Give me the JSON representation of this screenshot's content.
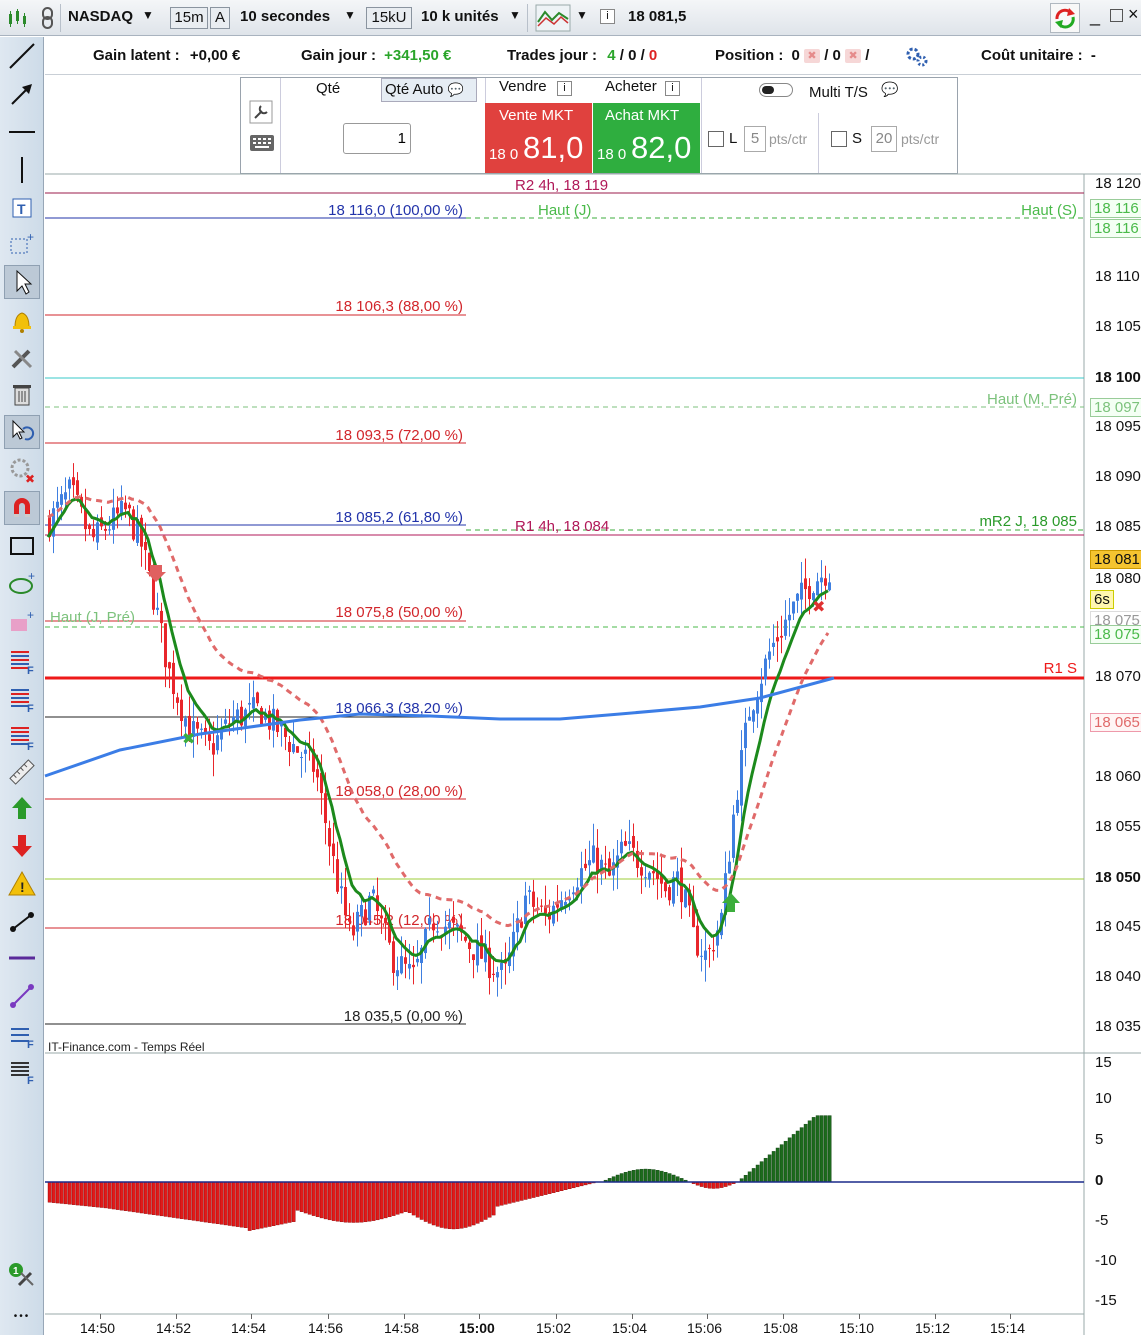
{
  "toolbar": {
    "symbol": "NASDAQ",
    "timeframe": "15m",
    "mode_a": "A",
    "interval": "10 secondes",
    "units_short": "15kU",
    "units": "10 k unités",
    "last_price": "18 081,5"
  },
  "infobar": {
    "gain_latent_label": "Gain latent :",
    "gain_latent_value": "+0,00 €",
    "gain_jour_label": "Gain jour :",
    "gain_jour_value": "+341,50 €",
    "trades_label": "Trades jour :",
    "trades_won": "4",
    "trades_sep1": "/",
    "trades_lost": "0",
    "trades_sep2": "/",
    "trades_open": "0",
    "position_label": "Position :",
    "position_long": "0",
    "position_sep1": "/",
    "position_short": "0",
    "position_sep2": "/",
    "cout_label": "Coût unitaire :",
    "cout_value": "-"
  },
  "order": {
    "qty_label": "Qté",
    "qty_auto_label": "Qté Auto",
    "qty_value": "1",
    "sell_label": "Vendre",
    "buy_label": "Acheter",
    "sell_mkt": "Vente MKT",
    "buy_mkt": "Achat MKT",
    "sell_price_small": "18 0",
    "sell_price_big": "81,0",
    "buy_price_small": "18 0",
    "buy_price_big": "82,0",
    "multi_ts": "Multi T/S",
    "l_label": "L",
    "l_value": "5",
    "s_label": "S",
    "s_value": "20",
    "pts_unit": "pts/ctr"
  },
  "chart": {
    "source": "IT-Finance.com - Temps Réel",
    "levels": {
      "r2_4h": "R2 4h, 18 119",
      "fib100": "18 116,0 (100,00 %)",
      "haut_j": "Haut (J)",
      "haut_s": "Haut (S)",
      "fib88": "18 106,3 (88,00 %)",
      "haut_m_pre": "Haut (M, Pré)",
      "fib72": "18 093,5 (72,00 %)",
      "fib618": "18 085,2 (61,80 %)",
      "r1_4h": "R1 4h, 18 084",
      "mr2_j": "mR2 J, 18 085",
      "haut_j_pre": "Haut (J, Pré)",
      "fib50": "18 075,8 (50,00 %)",
      "r1_s": "R1 S",
      "fib382": "18 066,3 (38,20 %)",
      "fib28": "18 058,0 (28,00 %)",
      "fib12": "18 045,2 (12,00 %)",
      "fib0": "18 035,5 (0,00 %)"
    },
    "price_axis": [
      "18 120",
      "18 110",
      "18 105",
      "18 100",
      "18 095",
      "18 090",
      "18 085",
      "18 080",
      "18 070",
      "18 060",
      "18 055",
      "18 050",
      "18 045",
      "18 040",
      "18 035"
    ],
    "axis_tags": {
      "haut_s_tag": "18 116",
      "haut_j_tag": "18 116",
      "haut_m_tag": "18 097",
      "last_tag": "18 081",
      "timer_tag": "6s",
      "fib50_tag": "18 075",
      "haut_j_pre_tag": "18 075",
      "ma_tag": "18 065"
    },
    "osc_axis": [
      "15",
      "10",
      "5",
      "0",
      "-5",
      "-10",
      "-15"
    ],
    "time_axis": [
      "14:50",
      "14:52",
      "14:54",
      "14:56",
      "14:58",
      "15:00",
      "15:02",
      "15:04",
      "15:06",
      "15:08",
      "15:10",
      "15:12",
      "15:14"
    ],
    "colors": {
      "up": "#3f7fe0",
      "down": "#e8262b",
      "ema_fast": "#1c8a1c",
      "ema_slow": "#e06a6a",
      "ma_long": "#3b7de6",
      "r1s": "#ee1a1a",
      "fib": "#d2262b",
      "fib_blue": "#2233aa"
    }
  }
}
